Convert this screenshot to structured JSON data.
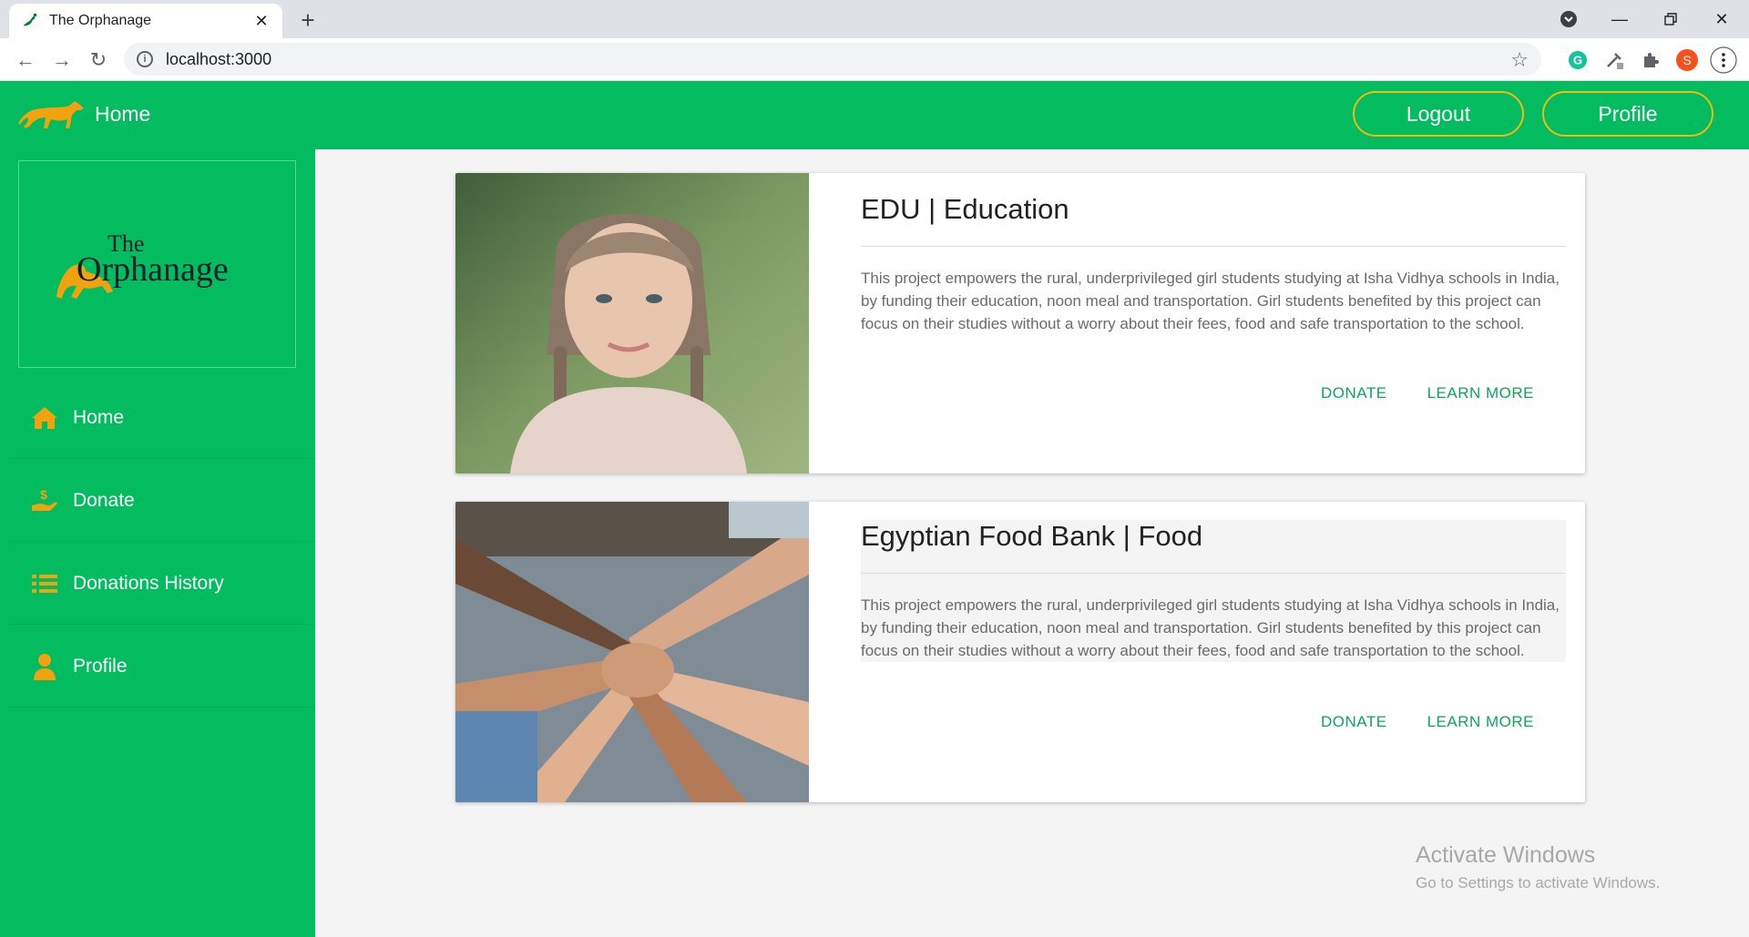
{
  "browser": {
    "tab_title": "The Orphanage",
    "url": "localhost:3000",
    "profile_initial": "S"
  },
  "header": {
    "brand_label": "Home",
    "logout_label": "Logout",
    "profile_label": "Profile"
  },
  "sidebar": {
    "logo_text_top": "The",
    "logo_text_main": "Orphanage",
    "items": [
      {
        "label": "Home",
        "icon": "home-icon"
      },
      {
        "label": "Donate",
        "icon": "donate-hand-icon"
      },
      {
        "label": "Donations History",
        "icon": "list-icon"
      },
      {
        "label": "Profile",
        "icon": "user-icon"
      }
    ]
  },
  "cards": [
    {
      "title": "EDU | Education",
      "description": "This project empowers the rural, underprivileged girl students studying at Isha Vidhya schools in India, by funding their education, noon meal and transportation. Girl students benefited by this project can focus on their studies without a worry about their fees, food and safe transportation to the school.",
      "donate_label": "DONATE",
      "learn_label": "LEARN MORE"
    },
    {
      "title": "Egyptian Food Bank | Food",
      "description": "This project empowers the rural, underprivileged girl students studying at Isha Vidhya schools in India, by funding their education, noon meal and transportation. Girl students benefited by this project can focus on their studies without a worry about their fees, food and safe transportation to the school.",
      "donate_label": "DONATE",
      "learn_label": "LEARN MORE"
    }
  ],
  "watermark": {
    "line1": "Activate Windows",
    "line2": "Go to Settings to activate Windows."
  },
  "colors": {
    "brand_green": "#02bc5f",
    "accent_orange": "#f2a10f",
    "action_green": "#0ea55a"
  }
}
